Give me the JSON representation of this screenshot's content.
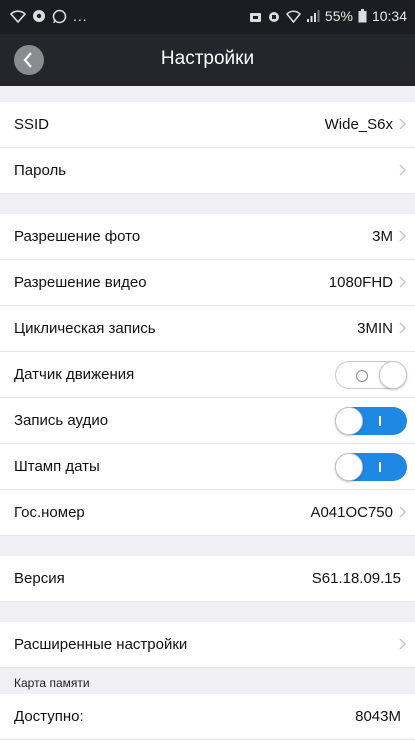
{
  "statusbar": {
    "left_more": "...",
    "battery": "55%",
    "time": "10:34"
  },
  "header": {
    "title": "Настройки"
  },
  "group1": [
    {
      "label": "SSID",
      "value": "Wide_S6x"
    },
    {
      "label": "Пароль",
      "value": ""
    }
  ],
  "group2": [
    {
      "label": "Разрешение фото",
      "value": "3M"
    },
    {
      "label": "Разрешение видео",
      "value": "1080FHD"
    },
    {
      "label": "Циклическая запись",
      "value": "3MIN"
    }
  ],
  "toggles": [
    {
      "label": "Датчик движения",
      "state": "off"
    },
    {
      "label": "Запись аудио",
      "state": "on"
    },
    {
      "label": "Штамп даты",
      "state": "on"
    }
  ],
  "plate": {
    "label": "Гос.номер",
    "value": "A041OC750"
  },
  "version": {
    "label": "Версия",
    "value": "S61.18.09.15"
  },
  "advanced": {
    "label": "Расширенные настройки"
  },
  "memory": {
    "caption": "Карта памяти",
    "available_label": "Доступно:",
    "available_value": "8043M"
  },
  "colors": {
    "accent": "#1e88e5",
    "titlebar": "#25262c",
    "statusbar": "#1c1d22"
  }
}
